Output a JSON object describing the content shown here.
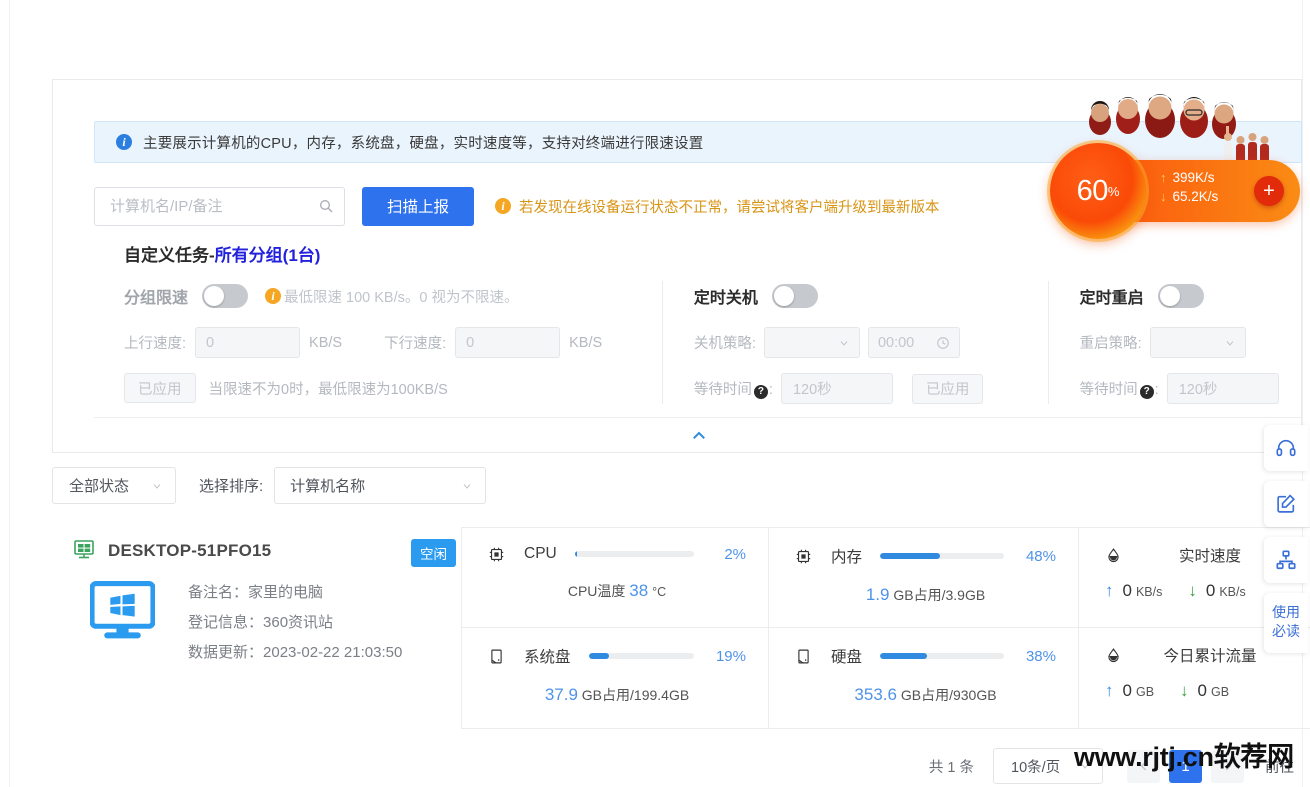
{
  "alert": {
    "icon": "info-icon",
    "text": "主要展示计算机的CPU，内存，系统盘，硬盘，实时速度等，支持对终端进行限速设置"
  },
  "search": {
    "placeholder": "计算机名/IP/备注",
    "value": "",
    "icon": "search-icon",
    "scan_button": "扫描上报",
    "warning": "若发现在线设备运行状态不正常，请尝试将客户端升级到最新版本"
  },
  "task": {
    "title_prefix": "自定义任务-",
    "title_group": "所有分组(1台)",
    "group_limit": {
      "label": "分组限速",
      "toggle_on": false,
      "hint": "最低限速 100 KB/s。0 视为不限速。",
      "upload_label": "上行速度:",
      "upload_value": "0",
      "upload_unit": "KB/S",
      "download_label": "下行速度:",
      "download_value": "0",
      "download_unit": "KB/S",
      "apply_button": "已应用",
      "apply_tip": "当限速不为0时，最低限速为100KB/S"
    },
    "shutdown": {
      "label": "定时关机",
      "toggle_on": false,
      "policy_label": "关机策略:",
      "policy_value": "",
      "time_value": "00:00",
      "time_icon": "clock-icon",
      "wait_label": "等待时间",
      "wait_value": "120秒",
      "apply_button": "已应用"
    },
    "restart": {
      "label": "定时重启",
      "toggle_on": false,
      "policy_label": "重启策略:",
      "policy_value": "",
      "wait_label": "等待时间",
      "wait_value": "120秒"
    },
    "collapse_icon": "chevron-up-icon"
  },
  "filters": {
    "status": "全部状态",
    "sort_label": "选择排序:",
    "sort_value": "计算机名称"
  },
  "device": {
    "icon": "windows-icon",
    "name": "DESKTOP-51PFO15",
    "status_badge": "空闲",
    "monitor_icon": "monitor-icon",
    "remark_label": "备注名：",
    "remark_value": "家里的电脑",
    "register_label": "登记信息：",
    "register_value": "360资讯站",
    "updated_label": "数据更新：",
    "updated_value": "2023-02-22 21:03:50",
    "metrics": [
      {
        "key": "cpu",
        "icon": "chip-icon",
        "label": "CPU",
        "percent": 2,
        "percent_text": "2%",
        "sub_label": "CPU温度",
        "sub_value": "38",
        "sub_unit": "°C"
      },
      {
        "key": "memory",
        "icon": "chip-icon",
        "label": "内存",
        "percent": 48,
        "percent_text": "48%",
        "sub_value": "1.9",
        "sub_suffix": "GB占用/3.9GB"
      },
      {
        "key": "system_disk",
        "icon": "disk-icon",
        "label": "系统盘",
        "percent": 19,
        "percent_text": "19%",
        "sub_value": "37.9",
        "sub_suffix": "GB占用/199.4GB"
      },
      {
        "key": "disk",
        "icon": "disk-icon",
        "label": "硬盘",
        "percent": 38,
        "percent_text": "38%",
        "sub_value": "353.6",
        "sub_suffix": "GB占用/930GB"
      }
    ],
    "speed_now": {
      "icon": "drop-icon",
      "title": "实时速度",
      "up_arrow": "↑",
      "up_value": "0",
      "up_unit": "KB/s",
      "down_arrow": "↓",
      "down_value": "0",
      "down_unit": "KB/s"
    },
    "traffic_today": {
      "icon": "drop-icon",
      "title": "今日累计流量",
      "up_arrow": "↑",
      "up_value": "0",
      "up_unit": "GB",
      "down_arrow": "↓",
      "down_value": "0",
      "down_unit": "GB"
    }
  },
  "pagination": {
    "total_text": "共 1 条",
    "page_size": "10条/页",
    "prev_icon": "chevron-left-icon",
    "next_icon": "chevron-right-icon",
    "current_page": "1",
    "goto": "前往"
  },
  "accelerator": {
    "percent": "60",
    "percent_symbol": "%",
    "up_arrow": "↑",
    "up_speed": "399K/s",
    "down_arrow": "↓",
    "down_speed": "65.2K/s",
    "plus": "+"
  },
  "right_tools": [
    {
      "icon": "headset-icon",
      "name": "support"
    },
    {
      "icon": "edit-icon",
      "name": "feedback"
    },
    {
      "icon": "sitemap-icon",
      "name": "topology"
    }
  ],
  "right_tool_text": "使用\n必读",
  "right_tool_text_line1": "使用",
  "right_tool_text_line2": "必读",
  "watermark": "www.rjtj.cn软荐网",
  "colors": {
    "primary": "#2f72ed",
    "accent_blue": "#2f8ae0",
    "warn": "#f5a623",
    "badge": "#2b9bf0",
    "accel_orange": "#fa6a10"
  }
}
